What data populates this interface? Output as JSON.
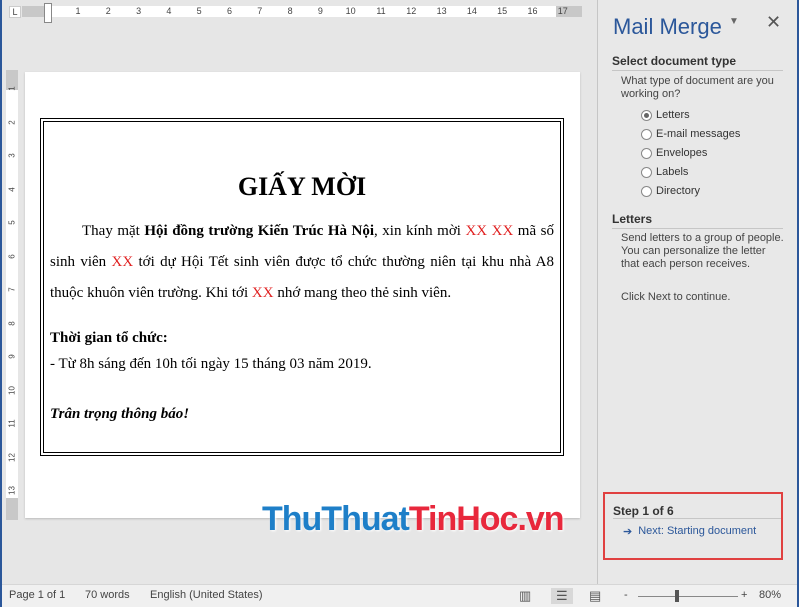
{
  "ruler": {
    "numbers": [
      "1",
      "2",
      "3",
      "4",
      "5",
      "6",
      "7",
      "8",
      "9",
      "10",
      "11",
      "12",
      "13",
      "14",
      "15",
      "16",
      "17"
    ],
    "vnumbers": [
      "1",
      "2",
      "3",
      "4",
      "5",
      "6",
      "7",
      "8",
      "9",
      "10",
      "11",
      "12",
      "13"
    ]
  },
  "document": {
    "title": "GIẤY MỜI",
    "p1": [
      "Thay mặt ",
      "Hội đồng trường Kiến Trúc Hà Nội",
      ", xin kính mời ",
      "XX XX",
      " mã số sinh viên ",
      "XX",
      " tới dự Hội Tết sinh viên được tổ chức thường niên tại khu nhà A8 thuộc khuôn viên trường. Khi tới ",
      "XX",
      " nhớ mang theo thẻ sinh viên."
    ],
    "time_heading": "Thời gian tổ chức:",
    "time_line": "- Từ 8h sáng đến 10h tối ngày 15 tháng 03 năm 2019.",
    "closing": "Trân trọng thông báo!"
  },
  "panel": {
    "title": "Mail Merge",
    "section1": "Select document type",
    "question": "What type of document are you working on?",
    "options": [
      "Letters",
      "E-mail messages",
      "Envelopes",
      "Labels",
      "Directory"
    ],
    "selected": "Letters",
    "section2": "Letters",
    "desc": "Send letters to a group of people. You can personalize the letter that each person receives.",
    "hint": "Click Next to continue.",
    "step": "Step 1 of 6",
    "next": "Next: Starting document"
  },
  "watermark": {
    "part1": "ThuThuat",
    "part2": "TinHoc",
    "part3": ".vn",
    "color1": "#1e7fc8",
    "color2": "#e8283c"
  },
  "status": {
    "page": "Page 1 of 1",
    "words": "70 words",
    "language": "English (United States)",
    "zoom": "80%",
    "zoom_minus": "-",
    "zoom_plus": "+"
  },
  "colors": {
    "accent": "#2b579a",
    "highlight_box": "#e04040",
    "placeholder_red": "#e02020"
  }
}
